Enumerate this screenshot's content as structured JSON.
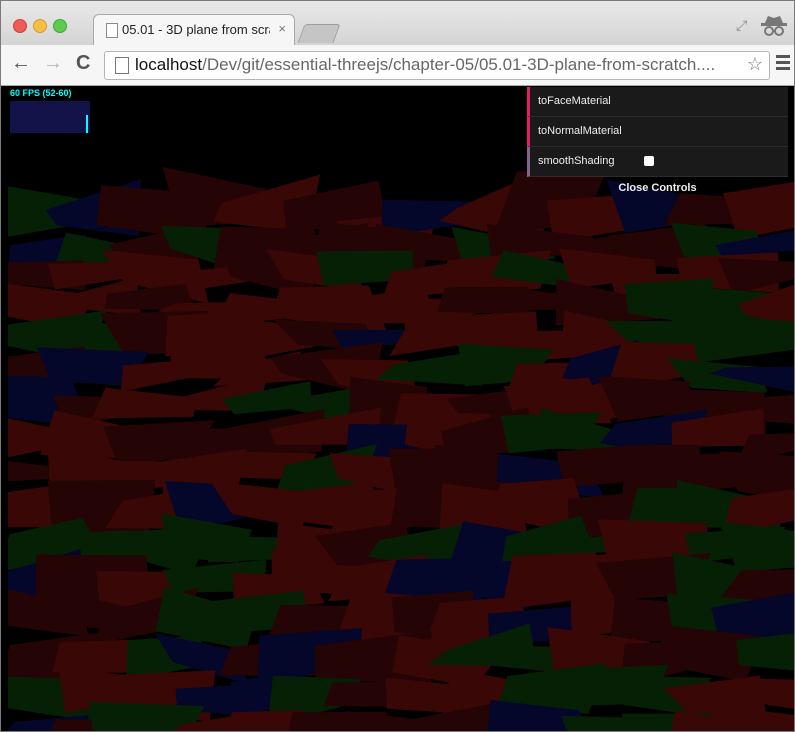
{
  "window": {
    "tab_title": "05.01 - 3D plane from scratch",
    "tab_close_glyph": "×",
    "icons": [
      "close-window-icon",
      "minimize-window-icon",
      "maximize-window-icon",
      "document-icon",
      "fullscreen-icon",
      "incognito-icon"
    ]
  },
  "toolbar": {
    "back_glyph": "←",
    "forward_glyph": "→",
    "reload_glyph": "C",
    "url_host": "localhost",
    "url_path": "/Dev/git/essential-threejs/chapter-05/05.01-3D-plane-from-scratch....",
    "star_glyph": "☆"
  },
  "stats": {
    "fps_text": "60 FPS (52-60)"
  },
  "gui": {
    "face_material_label": "toFaceMaterial",
    "normal_material_label": "toNormalMaterial",
    "smooth_shading_label": "smoothShading",
    "smooth_shading_checked": true,
    "close_label": "Close Controls"
  },
  "scene": {
    "colors": {
      "red": "#3a0707",
      "dark_red": "#240404",
      "green": "#062006",
      "blue": "#04062a",
      "background": "#000000"
    }
  }
}
